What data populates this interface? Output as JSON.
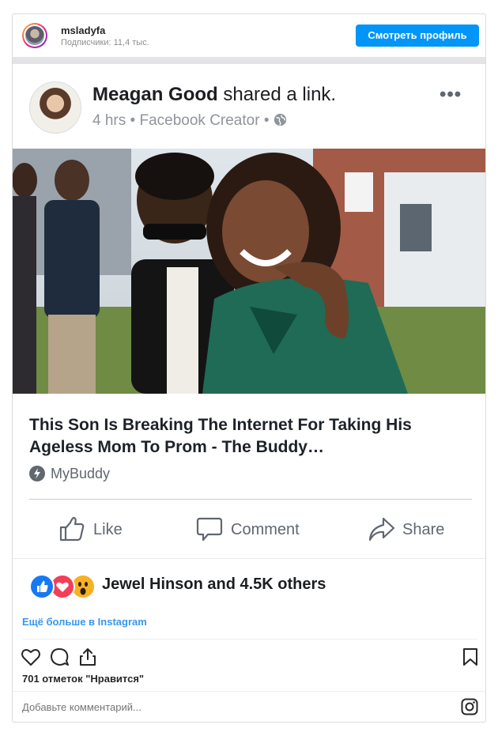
{
  "instagram": {
    "username": "msladyfa",
    "subscribers": "Подписчики: 11,4 тыс.",
    "view_profile": "Смотреть профиль",
    "more_link": "Ещё больше в Instagram",
    "likes": "701 отметок \"Нравится\"",
    "comment_placeholder": "Добавьте комментарий...",
    "accent_color": "#0095f6"
  },
  "facebook": {
    "author": "Meagan Good",
    "action": "shared a link.",
    "time": "4 hrs",
    "source": "Facebook Creator",
    "more": "•••",
    "link_title": "This Son Is Breaking The Internet For Taking His Ageless Mom To Prom - The Buddy…",
    "link_site": "MyBuddy",
    "actions": {
      "like": "Like",
      "comment": "Comment",
      "share": "Share"
    },
    "reactions_text": "Jewel Hinson and 4.5K others",
    "reactions": [
      "like-icon",
      "love-icon",
      "wow-icon"
    ]
  },
  "icons": [
    "heart-icon",
    "comment-icon",
    "share-icon",
    "bookmark-icon",
    "instagram-logo-icon",
    "globe-icon"
  ]
}
